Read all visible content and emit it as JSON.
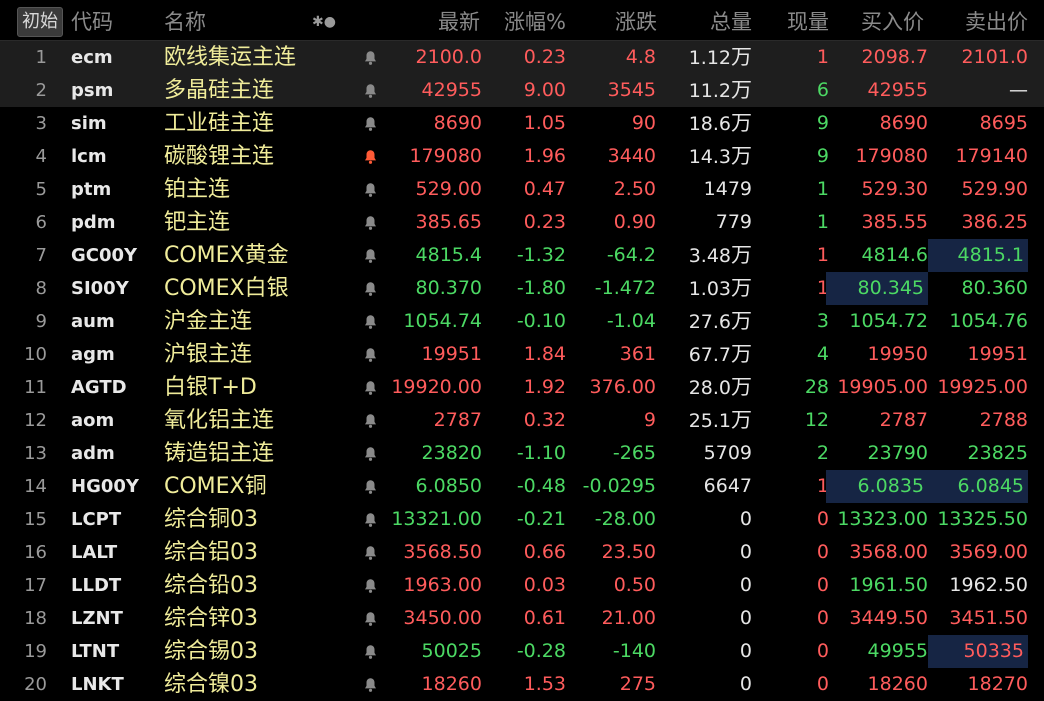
{
  "header": {
    "init_button": "初始",
    "columns": [
      "代码",
      "名称",
      "最新",
      "涨幅%",
      "涨跌",
      "总量",
      "现量",
      "买入价",
      "卖出价"
    ],
    "settings_glyph": "✱●"
  },
  "colors": {
    "up": "#ff5c5c",
    "down": "#4cd964",
    "neutral": "#e6e6e6",
    "name": "#f0ec9a",
    "bell_gray": "#8a8a8a",
    "bell_active": "#ff5a36",
    "box": "#162544"
  },
  "rows": [
    {
      "idx": "1",
      "code": "ecm",
      "name": "欧线集运主连",
      "last": "2100.0",
      "pct": "0.23",
      "chg": "4.8",
      "vol": "1.12",
      "vol_unit": "万",
      "cur": "1",
      "bid": "2098.7",
      "ask": "2101.0",
      "dir": "up",
      "hl": true,
      "bell": "gray",
      "bid_c": "up",
      "ask_c": "up",
      "cur_c": "up"
    },
    {
      "idx": "2",
      "code": "psm",
      "name": "多晶硅主连",
      "last": "42955",
      "pct": "9.00",
      "chg": "3545",
      "vol": "11.2",
      "vol_unit": "万",
      "cur": "6",
      "bid": "42955",
      "ask": "—",
      "dir": "up",
      "hl": true,
      "bell": "gray",
      "bid_c": "up",
      "ask_c": "neutral",
      "cur_c": "down"
    },
    {
      "idx": "3",
      "code": "sim",
      "name": "工业硅主连",
      "last": "8690",
      "pct": "1.05",
      "chg": "90",
      "vol": "18.6",
      "vol_unit": "万",
      "cur": "9",
      "bid": "8690",
      "ask": "8695",
      "dir": "up",
      "bell": "gray",
      "bid_c": "up",
      "ask_c": "up",
      "cur_c": "down"
    },
    {
      "idx": "4",
      "code": "lcm",
      "name": "碳酸锂主连",
      "last": "179080",
      "pct": "1.96",
      "chg": "3440",
      "vol": "14.3",
      "vol_unit": "万",
      "cur": "9",
      "bid": "179080",
      "ask": "179140",
      "dir": "up",
      "bell": "active",
      "bid_c": "up",
      "ask_c": "up",
      "cur_c": "down"
    },
    {
      "idx": "5",
      "code": "ptm",
      "name": "铂主连",
      "last": "529.00",
      "pct": "0.47",
      "chg": "2.50",
      "vol": "1479",
      "vol_unit": "",
      "cur": "1",
      "bid": "529.30",
      "ask": "529.90",
      "dir": "up",
      "bell": "gray",
      "bid_c": "up",
      "ask_c": "up",
      "cur_c": "down"
    },
    {
      "idx": "6",
      "code": "pdm",
      "name": "钯主连",
      "last": "385.65",
      "pct": "0.23",
      "chg": "0.90",
      "vol": "779",
      "vol_unit": "",
      "cur": "1",
      "bid": "385.55",
      "ask": "386.25",
      "dir": "up",
      "bell": "gray",
      "bid_c": "up",
      "ask_c": "up",
      "cur_c": "down"
    },
    {
      "idx": "7",
      "code": "GC00Y",
      "name": "COMEX黄金",
      "last": "4815.4",
      "pct": "-1.32",
      "chg": "-64.2",
      "vol": "3.48",
      "vol_unit": "万",
      "cur": "1",
      "bid": "4814.6",
      "ask": "4815.1",
      "dir": "down",
      "bell": "gray",
      "bid_c": "down",
      "ask_c": "down",
      "cur_c": "up",
      "box": "ask"
    },
    {
      "idx": "8",
      "code": "SI00Y",
      "name": "COMEX白银",
      "last": "80.370",
      "pct": "-1.80",
      "chg": "-1.472",
      "vol": "1.03",
      "vol_unit": "万",
      "cur": "1",
      "bid": "80.345",
      "ask": "80.360",
      "dir": "down",
      "bell": "gray",
      "bid_c": "down",
      "ask_c": "down",
      "cur_c": "up",
      "box": "bid"
    },
    {
      "idx": "9",
      "code": "aum",
      "name": "沪金主连",
      "last": "1054.74",
      "pct": "-0.10",
      "chg": "-1.04",
      "vol": "27.6",
      "vol_unit": "万",
      "cur": "3",
      "bid": "1054.72",
      "ask": "1054.76",
      "dir": "down",
      "bell": "gray",
      "bid_c": "down",
      "ask_c": "down",
      "cur_c": "down"
    },
    {
      "idx": "10",
      "code": "agm",
      "name": "沪银主连",
      "last": "19951",
      "pct": "1.84",
      "chg": "361",
      "vol": "67.7",
      "vol_unit": "万",
      "cur": "4",
      "bid": "19950",
      "ask": "19951",
      "dir": "up",
      "bell": "gray",
      "bid_c": "up",
      "ask_c": "up",
      "cur_c": "down"
    },
    {
      "idx": "11",
      "code": "AGTD",
      "name": "白银T+D",
      "last": "19920.00",
      "pct": "1.92",
      "chg": "376.00",
      "vol": "28.0",
      "vol_unit": "万",
      "cur": "28",
      "bid": "19905.00",
      "ask": "19925.00",
      "dir": "up",
      "bell": "gray",
      "bid_c": "up",
      "ask_c": "up",
      "cur_c": "down"
    },
    {
      "idx": "12",
      "code": "aom",
      "name": "氧化铝主连",
      "last": "2787",
      "pct": "0.32",
      "chg": "9",
      "vol": "25.1",
      "vol_unit": "万",
      "cur": "12",
      "bid": "2787",
      "ask": "2788",
      "dir": "up",
      "bell": "gray",
      "bid_c": "up",
      "ask_c": "up",
      "cur_c": "down"
    },
    {
      "idx": "13",
      "code": "adm",
      "name": "铸造铝主连",
      "last": "23820",
      "pct": "-1.10",
      "chg": "-265",
      "vol": "5709",
      "vol_unit": "",
      "cur": "2",
      "bid": "23790",
      "ask": "23825",
      "dir": "down",
      "bell": "gray",
      "bid_c": "down",
      "ask_c": "down",
      "cur_c": "down"
    },
    {
      "idx": "14",
      "code": "HG00Y",
      "name": "COMEX铜",
      "last": "6.0850",
      "pct": "-0.48",
      "chg": "-0.0295",
      "vol": "6647",
      "vol_unit": "",
      "cur": "1",
      "bid": "6.0835",
      "ask": "6.0845",
      "dir": "down",
      "bell": "gray",
      "bid_c": "down",
      "ask_c": "down",
      "cur_c": "up",
      "box": "both"
    },
    {
      "idx": "15",
      "code": "LCPT",
      "name": "综合铜03",
      "last": "13321.00",
      "pct": "-0.21",
      "chg": "-28.00",
      "vol": "0",
      "vol_unit": "",
      "cur": "0",
      "bid": "13323.00",
      "ask": "13325.50",
      "dir": "down",
      "bell": "gray",
      "bid_c": "down",
      "ask_c": "down",
      "cur_c": "up"
    },
    {
      "idx": "16",
      "code": "LALT",
      "name": "综合铝03",
      "last": "3568.50",
      "pct": "0.66",
      "chg": "23.50",
      "vol": "0",
      "vol_unit": "",
      "cur": "0",
      "bid": "3568.00",
      "ask": "3569.00",
      "dir": "up",
      "bell": "gray",
      "bid_c": "up",
      "ask_c": "up",
      "cur_c": "up"
    },
    {
      "idx": "17",
      "code": "LLDT",
      "name": "综合铅03",
      "last": "1963.00",
      "pct": "0.03",
      "chg": "0.50",
      "vol": "0",
      "vol_unit": "",
      "cur": "0",
      "bid": "1961.50",
      "ask": "1962.50",
      "dir": "up",
      "bell": "gray",
      "bid_c": "down",
      "ask_c": "neutral",
      "cur_c": "up"
    },
    {
      "idx": "18",
      "code": "LZNT",
      "name": "综合锌03",
      "last": "3450.00",
      "pct": "0.61",
      "chg": "21.00",
      "vol": "0",
      "vol_unit": "",
      "cur": "0",
      "bid": "3449.50",
      "ask": "3451.50",
      "dir": "up",
      "bell": "gray",
      "bid_c": "up",
      "ask_c": "up",
      "cur_c": "up"
    },
    {
      "idx": "19",
      "code": "LTNT",
      "name": "综合锡03",
      "last": "50025",
      "pct": "-0.28",
      "chg": "-140",
      "vol": "0",
      "vol_unit": "",
      "cur": "0",
      "bid": "49955",
      "ask": "50335",
      "dir": "down",
      "bell": "gray",
      "bid_c": "down",
      "ask_c": "up",
      "cur_c": "up",
      "box": "ask"
    },
    {
      "idx": "20",
      "code": "LNKT",
      "name": "综合镍03",
      "last": "18260",
      "pct": "1.53",
      "chg": "275",
      "vol": "0",
      "vol_unit": "",
      "cur": "0",
      "bid": "18260",
      "ask": "18270",
      "dir": "up",
      "bell": "gray",
      "bid_c": "up",
      "ask_c": "up",
      "cur_c": "up"
    }
  ]
}
